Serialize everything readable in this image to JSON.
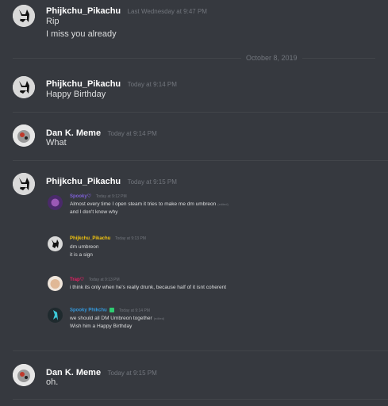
{
  "messages": [
    {
      "username": "Phijkchu_Pikachu",
      "timestamp": "Last Wednesday at 9:47 PM",
      "lines": [
        "Rip",
        "I miss you already"
      ]
    },
    {
      "username": "Phijkchu_Pikachu",
      "timestamp": "Today at 9:14 PM",
      "lines": [
        "Happy Birthday"
      ]
    },
    {
      "username": "Dan K. Meme",
      "timestamp": "Today at 9:14 PM",
      "lines": [
        "What"
      ]
    },
    {
      "username": "Phijkchu_Pikachu",
      "timestamp": "Today at 9:15 PM"
    },
    {
      "username": "Dan K. Meme",
      "timestamp": "Today at 9:15 PM",
      "lines": [
        "oh."
      ]
    }
  ],
  "date_divider": "October 8, 2019",
  "embedded": [
    {
      "username": "Spooky♡",
      "name_color": "#7f60d8",
      "timestamp": "Today at 9:12 PM",
      "lines": [
        "Almost every time I open steam it tries to make me dm umbreon",
        "and I don't know why"
      ],
      "edited": "(edited)"
    },
    {
      "username": "Phijkchu_Pikachu",
      "name_color": "#f1c40f",
      "timestamp": "Today at 9:13 PM",
      "lines": [
        "dm umbreon",
        "it is a sign"
      ]
    },
    {
      "username": "Trap♡",
      "name_color": "#e91e63",
      "timestamp": "Today at 9:13 PM",
      "lines": [
        "i think its only when he's really drunk, because half of it isnt coherent"
      ]
    },
    {
      "username": "Spooky Phikchu",
      "name_color": "#3498db",
      "timestamp": "Today at 9:14 PM",
      "lines": [
        "we should all DM Umbreon together",
        "Wish him a Happy Birthday"
      ],
      "edited": "(edited)"
    }
  ],
  "colors": {
    "background": "#36393f",
    "username": "#ffffff",
    "timestamp": "#72767d",
    "text": "#dcddde"
  }
}
